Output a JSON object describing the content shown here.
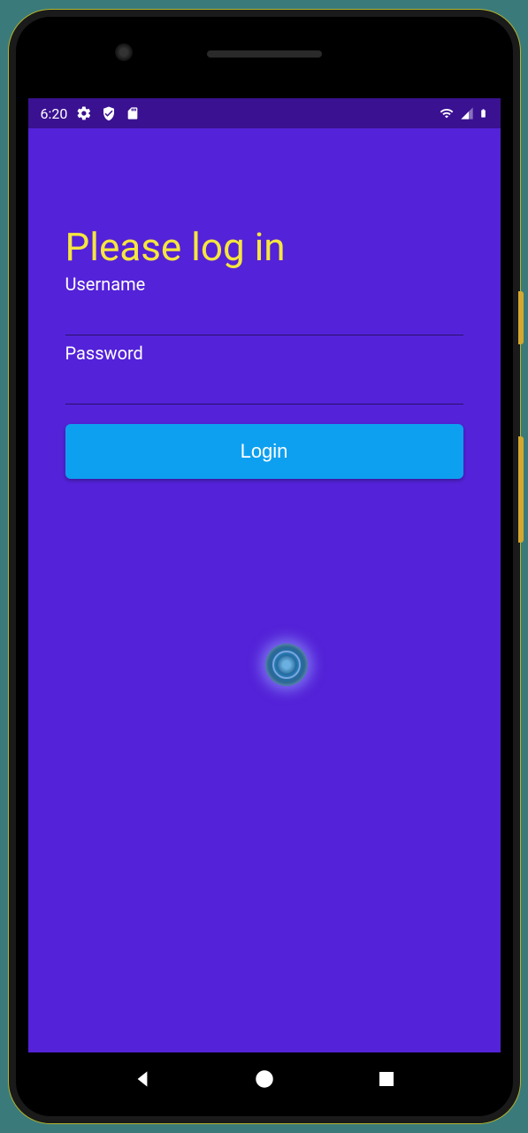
{
  "status_bar": {
    "time": "6:20"
  },
  "login": {
    "title": "Please log in",
    "username_label": "Username",
    "username_value": "",
    "password_label": "Password",
    "password_value": "",
    "button_label": "Login"
  }
}
